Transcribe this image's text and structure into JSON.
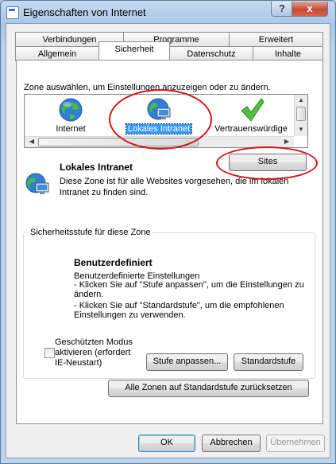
{
  "window": {
    "title": "Eigenschaften von Internet",
    "help_glyph": "?",
    "close_glyph": "x"
  },
  "tabs": {
    "row1": [
      "Verbindungen",
      "Programme",
      "Erweitert"
    ],
    "row2": [
      "Allgemein",
      "Sicherheit",
      "Datenschutz",
      "Inhalte"
    ],
    "active": "Sicherheit"
  },
  "zones": {
    "instruction": "Zone auswählen, um Einstellungen anzuzeigen oder zu ändern.",
    "items": [
      {
        "label": "Internet",
        "icon": "globe-icon"
      },
      {
        "label": "Lokales Intranet",
        "icon": "intranet-icon",
        "selected": true
      },
      {
        "label": "Vertrauenswürdige",
        "icon": "checkmark-icon"
      }
    ]
  },
  "zone_detail": {
    "name": "Lokales Intranet",
    "description": "Diese Zone ist für alle Websites vorgesehen, die im lokalen Intranet zu finden sind.",
    "sites_button": "Sites"
  },
  "security": {
    "group_title": "Sicherheitsstufe für diese Zone",
    "level_title": "Benutzerdefiniert",
    "level_lines": [
      "Benutzerdefinierte Einstellungen",
      "- Klicken Sie auf \"Stufe anpassen\", um die Einstellungen zu",
      "ändern.",
      "- Klicken Sie auf \"Standardstufe\", um die empfohlenen",
      "Einstellungen zu verwenden."
    ],
    "protected_mode_lines": [
      "Geschützten Modus",
      "aktivieren (erfordert",
      "IE-Neustart)"
    ],
    "protected_mode_checked": false,
    "customize_button": "Stufe anpassen...",
    "default_button": "Standardstufe",
    "reset_all_button": "Alle Zonen auf Standardstufe zurücksetzen"
  },
  "dialog_buttons": {
    "ok": "OK",
    "cancel": "Abbrechen",
    "apply": "Übernehmen"
  },
  "colors": {
    "annotation_red": "#d01818",
    "selection_blue": "#3399ff"
  }
}
